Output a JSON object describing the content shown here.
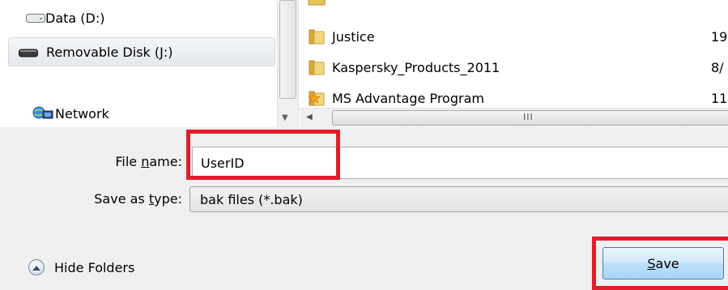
{
  "nav": {
    "items": [
      {
        "label": "Data (D:)",
        "icon": "drive-icon"
      },
      {
        "label": "Removable Disk (J:)",
        "icon": "removable-disk-icon"
      },
      {
        "label": "Network",
        "icon": "network-icon"
      }
    ]
  },
  "files": {
    "rows": [
      {
        "name": "Justice",
        "date": "19"
      },
      {
        "name": "Kaspersky_Products_2011",
        "date": "8/"
      },
      {
        "name": "MS Advantage Program",
        "date": "11"
      }
    ]
  },
  "form": {
    "filename_label_pre": "File ",
    "filename_label_u": "n",
    "filename_label_post": "ame:",
    "filename_value": "UserID",
    "type_label_pre": "Save as ",
    "type_label_u": "t",
    "type_label_post": "ype:",
    "type_value": "bak files (*.bak)"
  },
  "footer": {
    "hide_folders_label": "Hide Folders",
    "save_u": "S",
    "save_rest": "ave"
  },
  "colors": {
    "highlight": "#e21d2a",
    "save_button": "#bee0f8"
  }
}
